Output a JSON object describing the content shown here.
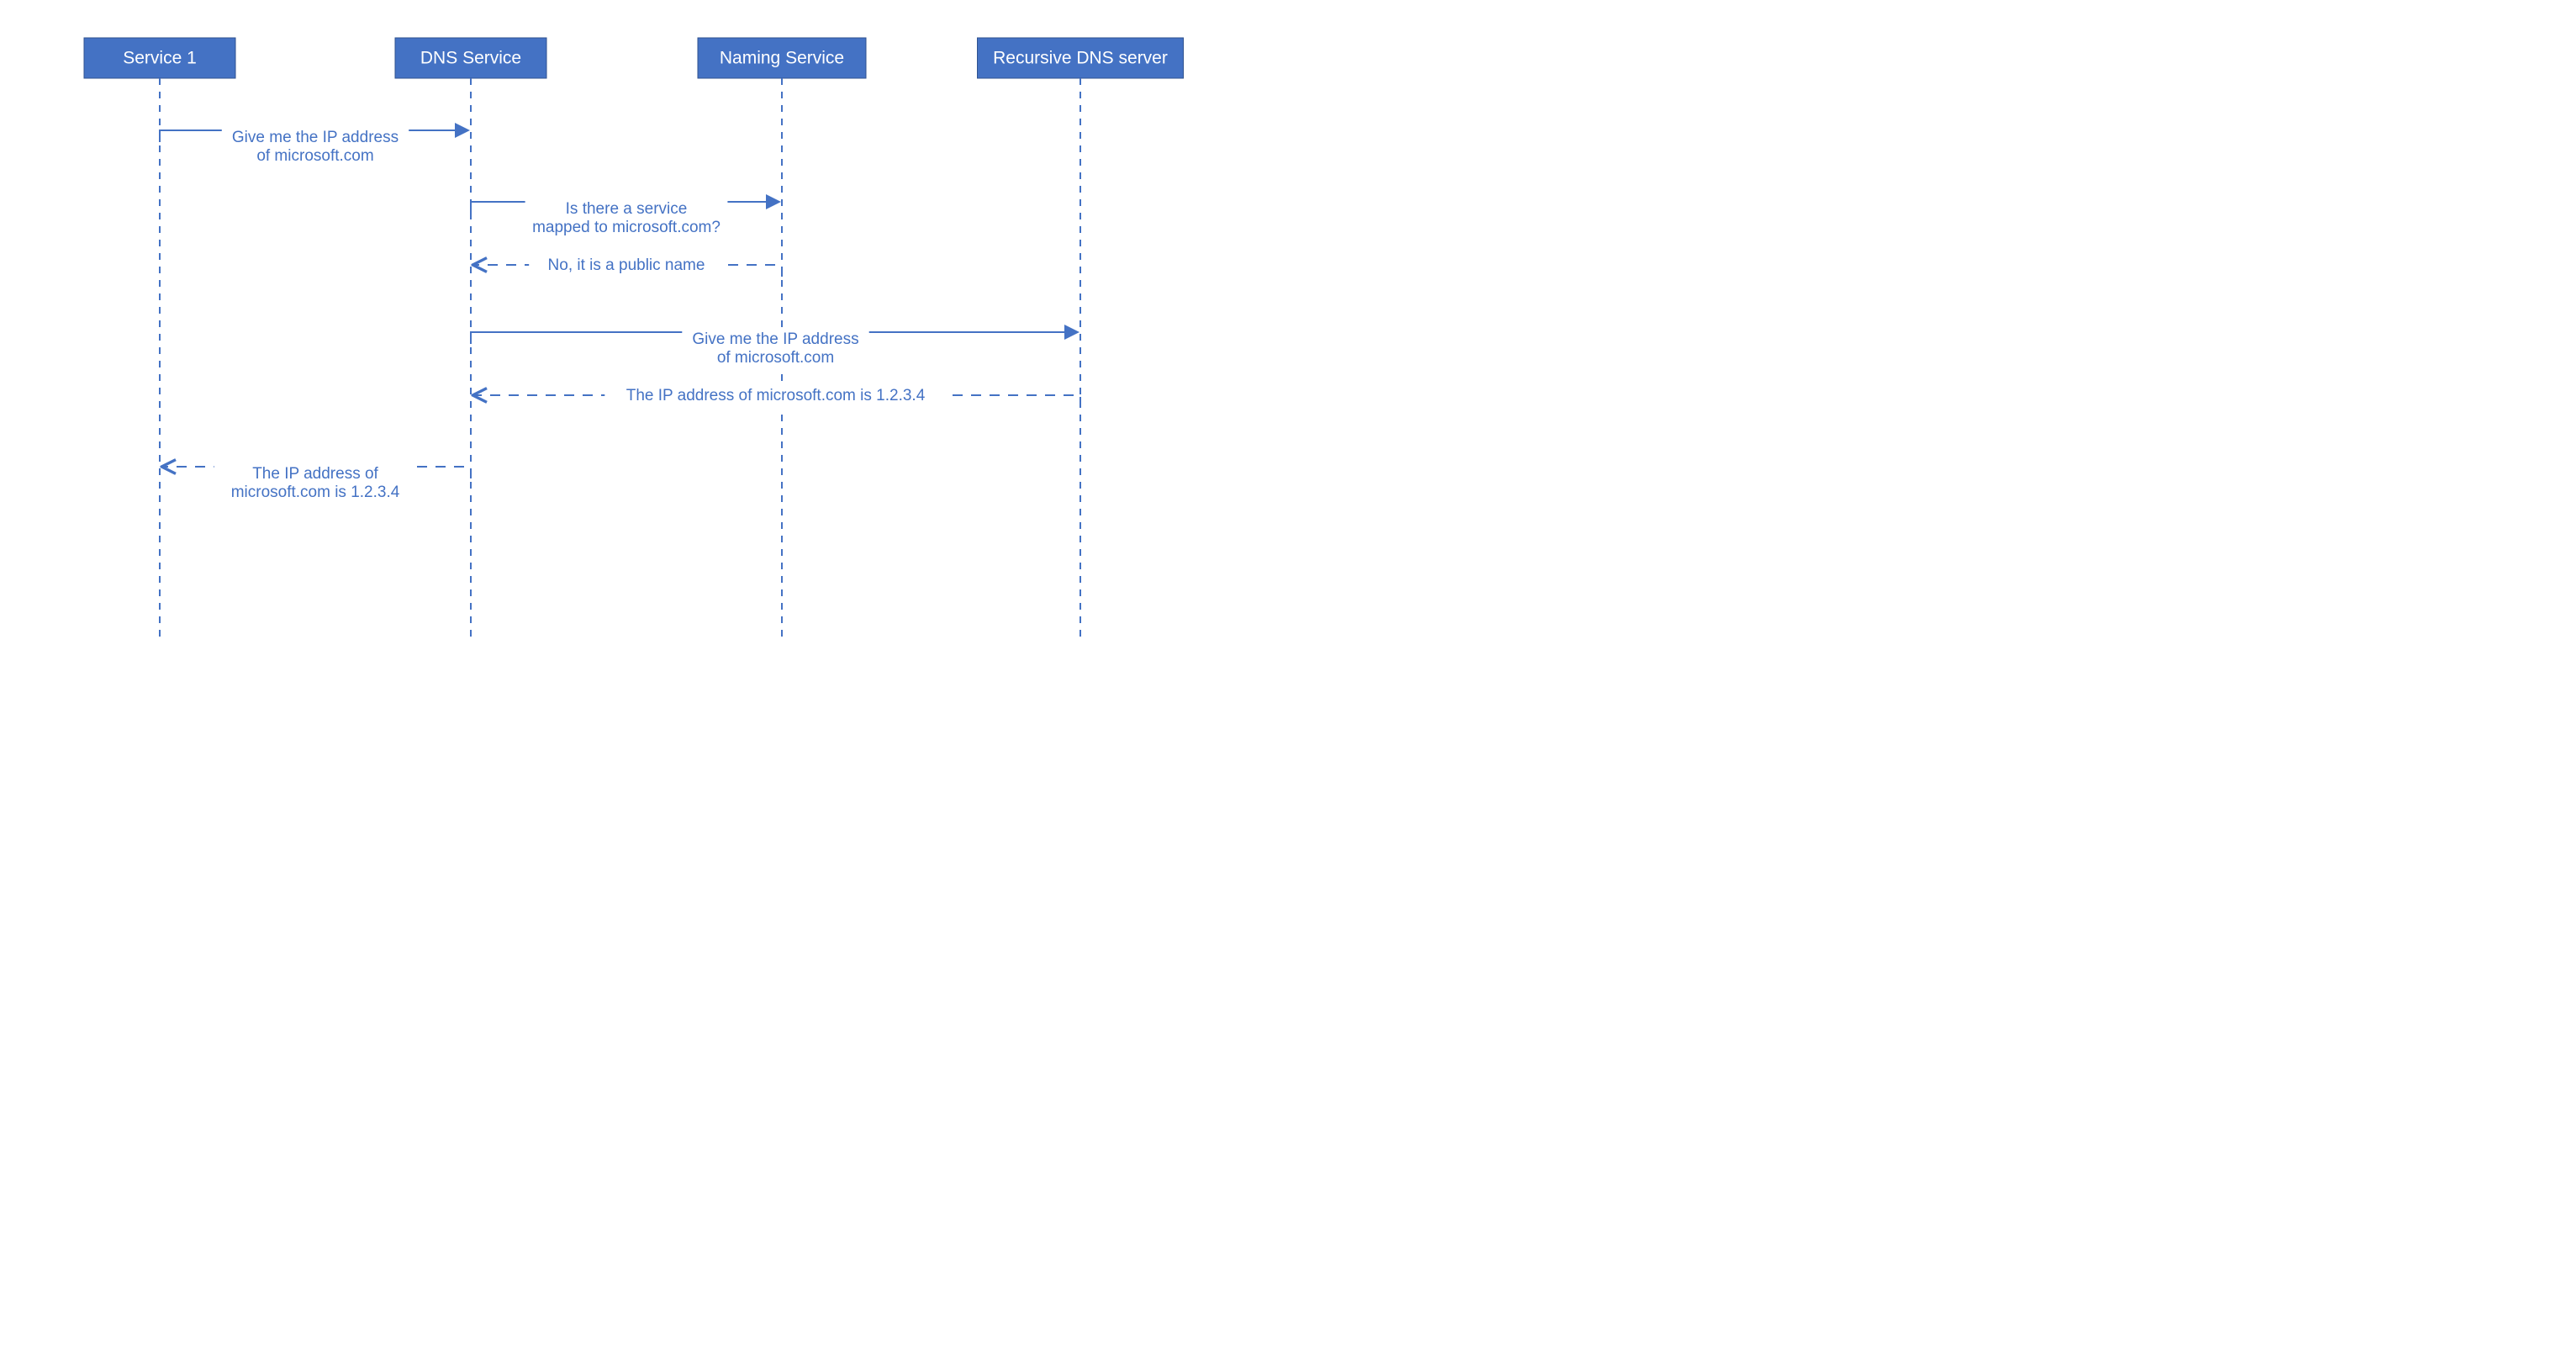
{
  "participants": [
    {
      "id": "p1",
      "label": "Service 1"
    },
    {
      "id": "p2",
      "label": "DNS Service"
    },
    {
      "id": "p3",
      "label": "Naming Service"
    },
    {
      "id": "p4",
      "label": "Recursive DNS server"
    }
  ],
  "messages": [
    {
      "from": "p1",
      "to": "p2",
      "style": "solid",
      "lines": [
        "Give me the IP address",
        "of microsoft.com"
      ]
    },
    {
      "from": "p2",
      "to": "p3",
      "style": "solid",
      "lines": [
        "Is there a service",
        "mapped to microsoft.com?"
      ]
    },
    {
      "from": "p3",
      "to": "p2",
      "style": "dashed",
      "lines": [
        "No, it is a public name"
      ]
    },
    {
      "from": "p2",
      "to": "p4",
      "style": "solid",
      "lines": [
        "Give me the IP address",
        "of microsoft.com"
      ]
    },
    {
      "from": "p4",
      "to": "p2",
      "style": "dashed",
      "lines": [
        "The IP address of microsoft.com is 1.2.3.4"
      ]
    },
    {
      "from": "p2",
      "to": "p1",
      "style": "dashed",
      "lines": [
        "The IP address of",
        "microsoft.com is 1.2.3.4"
      ]
    }
  ],
  "colors": {
    "primary": "#4472C4",
    "border": "#2F528F",
    "bg": "#ffffff"
  }
}
